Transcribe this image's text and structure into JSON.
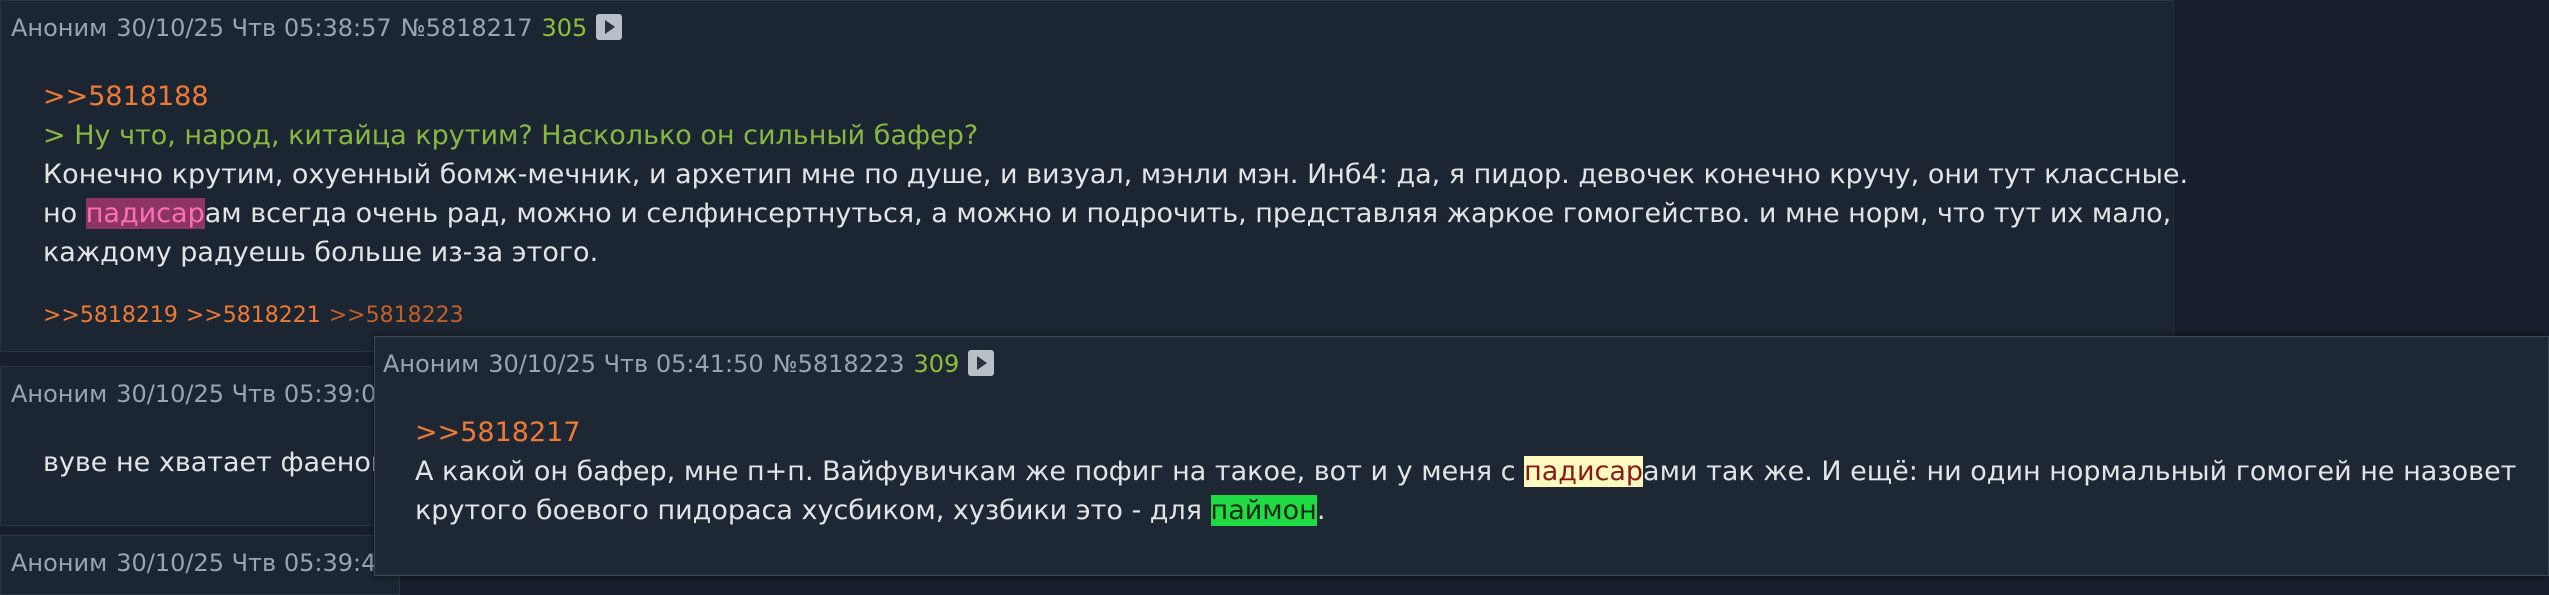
{
  "post1": {
    "author": "Аноним",
    "date": "30/10/25 Чтв 05:38:57",
    "number": "№5818217",
    "replies": "305",
    "reply_link": ">>5818188",
    "quote": "> Ну что, народ, китайца крутим? Насколько он сильный бафер?",
    "line1": "Конечно крутим, охуенный бомж-мечник, и архетип мне по душе, и визуал, мэнли мэн. Инб4: да, я пидор. девочек конечно кручу, они тут классные.",
    "line2_pre": "но ",
    "line2_hl": "падисар",
    "line2_post": "ам всегда очень рад, можно и селфинсертнуться, а можно и подрочить, представляя жаркое гомогейство. и мне норм, что тут их мало,",
    "line3": "каждому радуешь больше из-за этого.",
    "backlinks": [
      ">>5818219",
      ">>5818221",
      ">>5818223"
    ]
  },
  "post2": {
    "author": "Аноним",
    "date_partial": "30/10/25 Чтв 05:39:0",
    "text_partial": "вуве не хватает фаенона"
  },
  "post3": {
    "author": "Аноним",
    "date_partial": "30/10/25 Чтв 05:39:4"
  },
  "popup": {
    "author": "Аноним",
    "date": "30/10/25 Чтв 05:41:50",
    "number": "№5818223",
    "replies": "309",
    "reply_link": ">>5818217",
    "line1_pre": "А какой он бафер, мне п+п. Вайфувичкам же пофиг на такое, вот и у меня с ",
    "line1_hl": "падисар",
    "line1_post": "ами так же. И ещё: ни один нормальный гомогей не назовет",
    "line2_pre": "крутого боевого пидораса хусбиком, хузбики это - для ",
    "line2_hl": "паймон",
    "line2_post": "."
  },
  "icons": {
    "play": "play-icon"
  },
  "colors": {
    "background": "#161f2b",
    "post_bg": "#1c2632",
    "link": "#ee7a35",
    "quote": "#88b842",
    "replies": "#90bd39"
  }
}
